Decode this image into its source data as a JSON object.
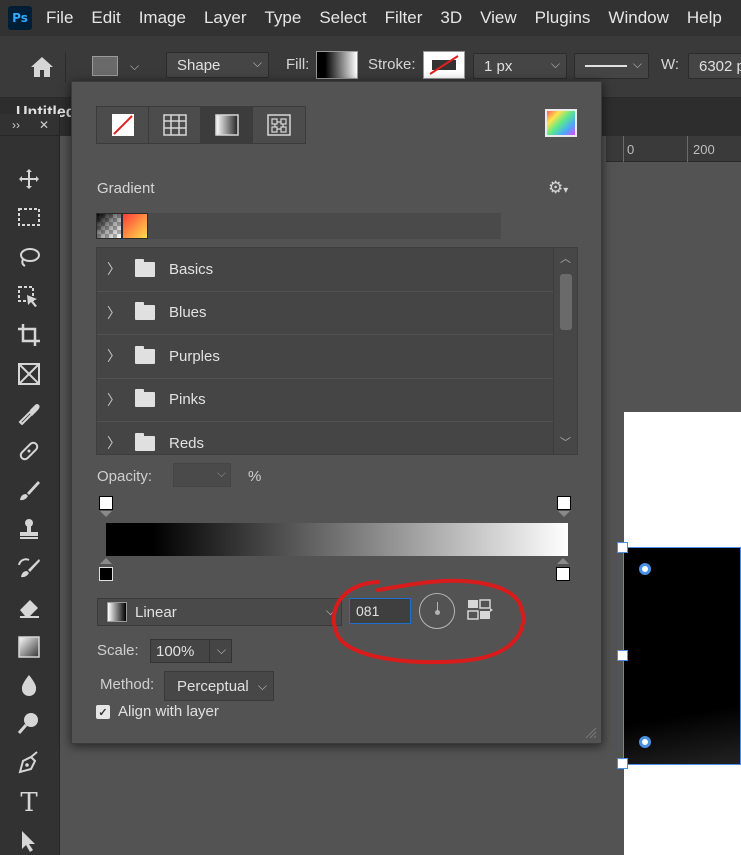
{
  "app": {
    "logo_text": "Ps"
  },
  "menu": [
    "File",
    "Edit",
    "Image",
    "Layer",
    "Type",
    "Select",
    "Filter",
    "3D",
    "View",
    "Plugins",
    "Window",
    "Help"
  ],
  "options_bar": {
    "mode_value": "Shape",
    "fill_label": "Fill:",
    "stroke_label": "Stroke:",
    "stroke_width_value": "1 px",
    "width_label": "W:",
    "width_value": "6302 p"
  },
  "document": {
    "tab_title": "Untitled",
    "ruler_ticks": [
      "0",
      "200"
    ]
  },
  "fill_panel": {
    "fill_types": [
      "no-fill-icon",
      "solid-color-icon",
      "gradient-icon",
      "pattern-icon"
    ],
    "active_fill_type": "gradient-icon",
    "section_title": "Gradient",
    "gear_glyph": "⚙",
    "gradient_folders": [
      "Basics",
      "Blues",
      "Purples",
      "Pinks",
      "Reds"
    ],
    "opacity_label": "Opacity:",
    "opacity_value": "",
    "opacity_unit": "%",
    "gradient_type_value": "Linear",
    "angle_value": "081",
    "scale_label": "Scale:",
    "scale_value": "100%",
    "method_label": "Method:",
    "method_value": "Perceptual",
    "align_with_layer_label": "Align with layer",
    "align_with_layer_checked": true
  },
  "colors": {
    "highlight": "#d81b1b",
    "selection": "#4a90e2",
    "panel_bg": "#535353"
  }
}
